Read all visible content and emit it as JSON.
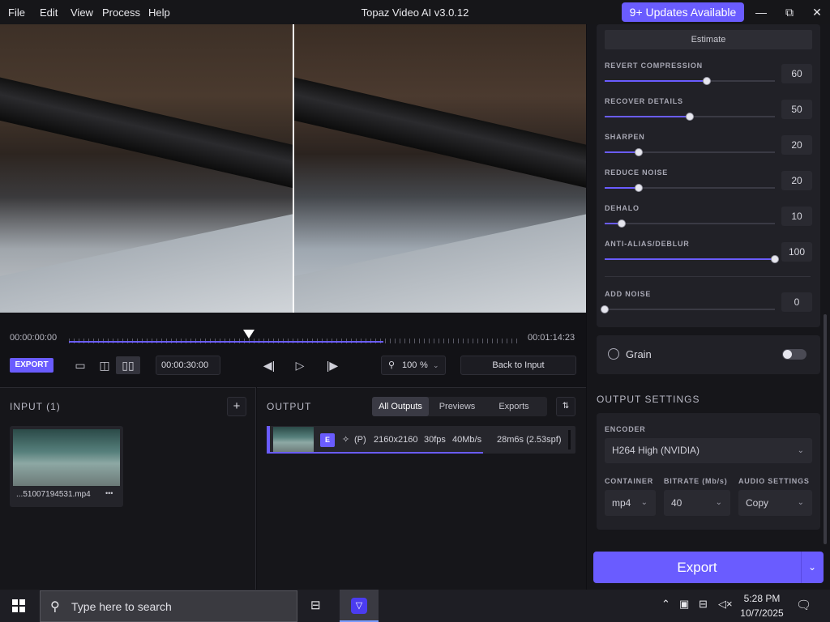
{
  "menu": [
    "File",
    "Edit",
    "View",
    "Process",
    "Help"
  ],
  "app_title": "Topaz Video AI  v3.0.12",
  "updates_label": "9+ Updates Available",
  "window_controls": {
    "minimize": "—",
    "maximize": "⧉",
    "close": "✕"
  },
  "timeline": {
    "start_time": "00:00:00:00",
    "end_time": "00:01:14:23",
    "progress": 0.7,
    "export_label": "EXPORT",
    "duration_value": "00:00:30:00",
    "zoom_value": "100",
    "zoom_unit": "%",
    "back_label": "Back to Input"
  },
  "input_panel": {
    "title": "INPUT (1)",
    "add_icon": "+",
    "file_name": "...51007194531.mp4",
    "more_icon": "•••"
  },
  "output_panel": {
    "title": "OUTPUT",
    "tabs": [
      "All Outputs",
      "Previews",
      "Exports"
    ],
    "active_tab": "All Outputs",
    "row": {
      "badge": "E",
      "mode": "(P)",
      "resolution": "2160x2160",
      "fps": "30fps",
      "bitrate": "40Mb/s",
      "time": "28m6s (2.53spf)",
      "progress": 0.7
    }
  },
  "settings": {
    "estimate_label": "Estimate",
    "sliders": [
      {
        "label": "REVERT COMPRESSION",
        "value": "60",
        "fraction": 0.6
      },
      {
        "label": "RECOVER DETAILS",
        "value": "50",
        "fraction": 0.5
      },
      {
        "label": "SHARPEN",
        "value": "20",
        "fraction": 0.2
      },
      {
        "label": "REDUCE NOISE",
        "value": "20",
        "fraction": 0.2
      },
      {
        "label": "DEHALO",
        "value": "10",
        "fraction": 0.1
      },
      {
        "label": "ANTI-ALIAS/DEBLUR",
        "value": "100",
        "fraction": 1.0
      },
      {
        "label": "ADD NOISE",
        "value": "0",
        "fraction": 0.0
      }
    ],
    "grain_label": "Grain",
    "grain_enabled": false,
    "output_settings_title": "OUTPUT SETTINGS",
    "encoder_label": "ENCODER",
    "encoder_value": "H264 High (NVIDIA)",
    "container_label": "CONTAINER",
    "container_value": "mp4",
    "bitrate_label": "BITRATE (Mb/s)",
    "bitrate_value": "40",
    "audio_label": "AUDIO SETTINGS",
    "audio_value": "Copy",
    "export_label": "Export"
  },
  "taskbar": {
    "search_placeholder": "Type here to search",
    "time": "5:28 PM",
    "date": "10/7/2025"
  },
  "colors": {
    "accent": "#6a5cff",
    "background": "#16161a",
    "panel": "#212127"
  }
}
